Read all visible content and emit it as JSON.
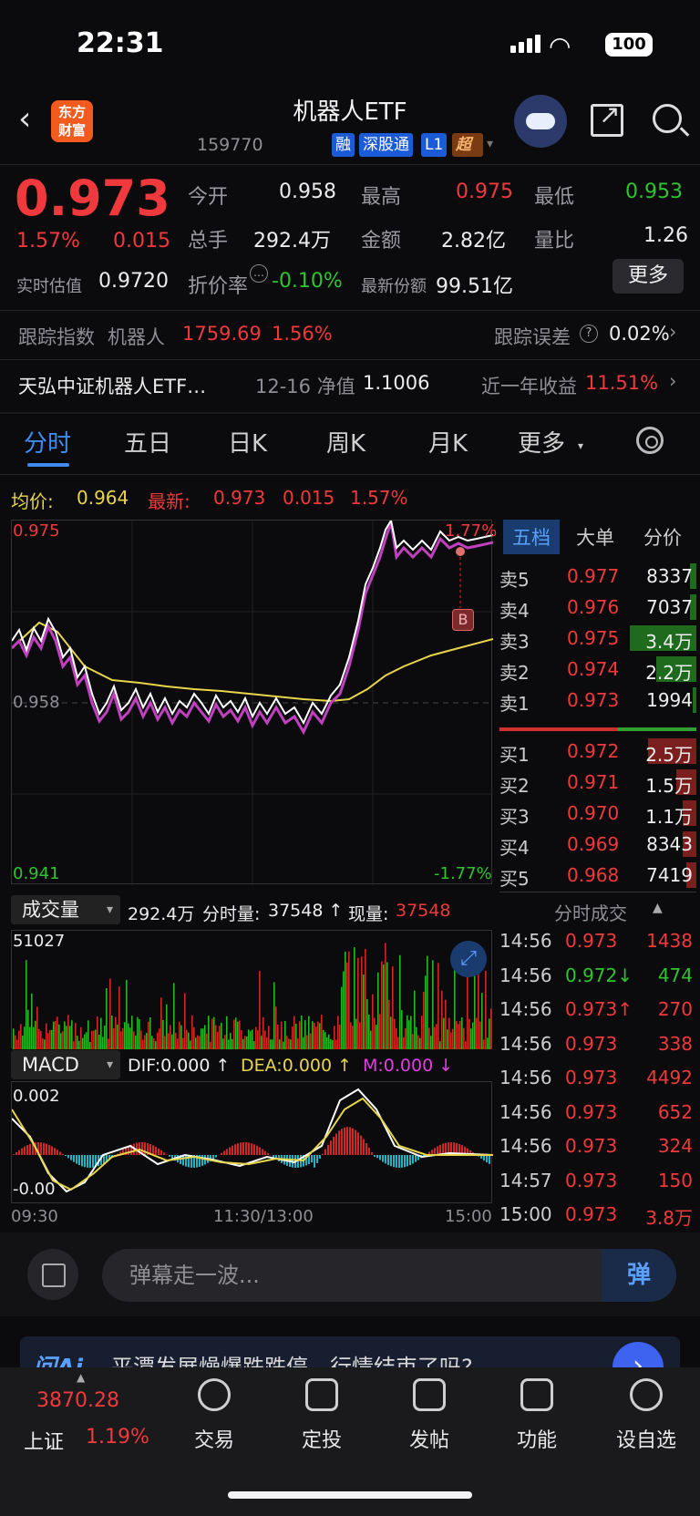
{
  "status": {
    "time": "22:31",
    "battery": "100"
  },
  "header": {
    "title": "机器人ETF",
    "logo": "东方\n财富",
    "code": "159770",
    "tags": [
      "融",
      "深股通",
      "L1",
      "超级"
    ],
    "icons": [
      "back-icon",
      "robot-avatar-icon",
      "share-icon",
      "search-icon"
    ]
  },
  "quote": {
    "price": "0.973",
    "change_pct": "1.57%",
    "change": "0.015",
    "open_label": "今开",
    "open": "0.958",
    "high_label": "最高",
    "high": "0.975",
    "low_label": "最低",
    "low": "0.953",
    "volume_label": "总手",
    "volume": "292.4万",
    "amount_label": "金额",
    "amount": "2.82亿",
    "ratio_label": "量比",
    "ratio": "1.26",
    "est_label": "实时估值",
    "est": "0.9720",
    "discount_label": "折价率",
    "discount": "-0.10%",
    "shares_label": "最新份额",
    "shares": "99.51亿",
    "more_label": "更多"
  },
  "tracking": {
    "label": "跟踪指数",
    "index": "机器人",
    "value": "1759.69",
    "pct": "1.56%",
    "error_label": "跟踪误差",
    "error": "0.02%"
  },
  "fund": {
    "name": "天弘中证机器人ETF…",
    "nav_label": "12-16 净值",
    "nav": "1.1006",
    "year_label": "近一年收益",
    "year": "11.51%"
  },
  "tabs": [
    "分时",
    "五日",
    "日K",
    "周K",
    "月K",
    "更多"
  ],
  "chart_info": {
    "avg_label": "均价:",
    "avg": "0.964",
    "last_label": "最新:",
    "last": "0.973",
    "last_chg": "0.015",
    "last_pct": "1.57%",
    "top": "0.975",
    "mid": "0.958",
    "bottom": "0.941",
    "top_pct": "1.77%",
    "bottom_pct": "-1.77%",
    "marker": "B"
  },
  "volume": {
    "selector": "成交量",
    "total": "292.4万",
    "minute_label": "分时量:",
    "minute": "37548 ↑",
    "now_label": "现量:",
    "now": "37548",
    "max": "51027"
  },
  "macd": {
    "selector": "MACD",
    "dif": "DIF:0.000 ↑",
    "dea": "DEA:0.000 ↑",
    "m": "M:0.000 ↓",
    "top": "0.002",
    "bottom": "-0.00",
    "x_labels": [
      "09:30",
      "11:30/13:00",
      "15:00"
    ]
  },
  "orderbook": {
    "tabs": [
      "五档",
      "大单",
      "分价"
    ],
    "sell": [
      {
        "label": "卖5",
        "price": "0.977",
        "vol": "8337",
        "bar": 0.1
      },
      {
        "label": "卖4",
        "price": "0.976",
        "vol": "7037",
        "bar": 0.1
      },
      {
        "label": "卖3",
        "price": "0.975",
        "vol": "3.4万",
        "bar": 0.98
      },
      {
        "label": "卖2",
        "price": "0.974",
        "vol": "2.2万",
        "bar": 0.6
      },
      {
        "label": "卖1",
        "price": "0.973",
        "vol": "1994",
        "bar": 0.05
      }
    ],
    "buy": [
      {
        "label": "买1",
        "price": "0.972",
        "vol": "2.5万",
        "bar": 0.72
      },
      {
        "label": "买2",
        "price": "0.971",
        "vol": "1.5万",
        "bar": 0.3
      },
      {
        "label": "买3",
        "price": "0.970",
        "vol": "1.1万",
        "bar": 0.2
      },
      {
        "label": "买4",
        "price": "0.969",
        "vol": "8343",
        "bar": 0.2
      },
      {
        "label": "买5",
        "price": "0.968",
        "vol": "7419",
        "bar": 0.15
      }
    ],
    "ticks_label": "分时成交",
    "ticks": [
      {
        "t": "14:56",
        "p": "0.973",
        "v": "1438",
        "dir": "up"
      },
      {
        "t": "14:56",
        "p": "0.972↓",
        "v": "474",
        "dir": "down"
      },
      {
        "t": "14:56",
        "p": "0.973↑",
        "v": "270",
        "dir": "up"
      },
      {
        "t": "14:56",
        "p": "0.973",
        "v": "338",
        "dir": "up"
      },
      {
        "t": "14:56",
        "p": "0.973",
        "v": "4492",
        "dir": "up"
      },
      {
        "t": "14:56",
        "p": "0.973",
        "v": "652",
        "dir": "up"
      },
      {
        "t": "14:56",
        "p": "0.973",
        "v": "324",
        "dir": "up"
      },
      {
        "t": "14:57",
        "p": "0.973",
        "v": "150",
        "dir": "up"
      },
      {
        "t": "15:00",
        "p": "0.973",
        "v": "3.8万",
        "dir": "up"
      }
    ]
  },
  "comment": {
    "placeholder": "弹幕走一波...",
    "danmu": "弹"
  },
  "banner": {
    "ai": "问Ai",
    "text": "平潭发展燥爆跌跌停，行情结束了吗?",
    "go": "›"
  },
  "bottom_nav": {
    "index_value": "3870.28",
    "index_name": "上证",
    "index_pct": "1.19%",
    "items": [
      "交易",
      "定投",
      "发帖",
      "功能",
      "设自选"
    ]
  },
  "colors": {
    "up": "#f0393c",
    "down": "#2fc42f",
    "accent": "#3f8cf0",
    "avg_line": "#e8d54a"
  }
}
